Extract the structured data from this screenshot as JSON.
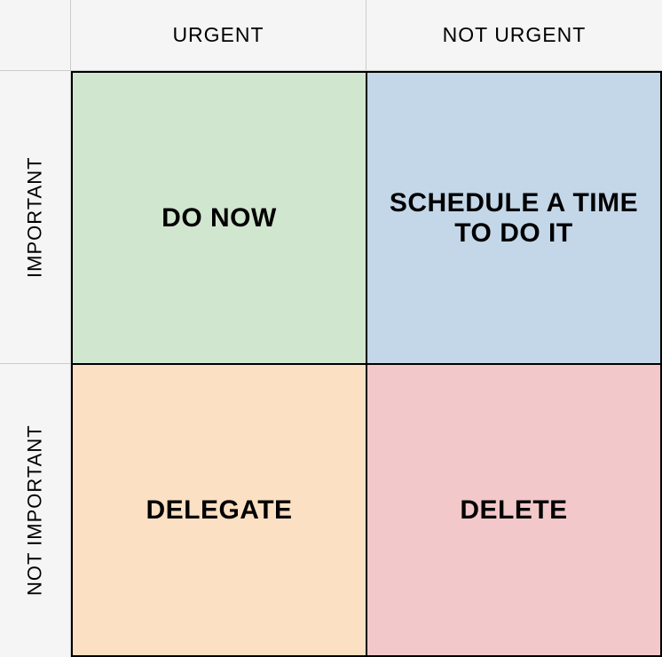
{
  "columns": {
    "urgent": "URGENT",
    "not_urgent": "NOT URGENT"
  },
  "rows": {
    "important": "IMPORTANT",
    "not_important": "NOT IMPORTANT"
  },
  "quadrants": {
    "do_now": {
      "label": "DO NOW",
      "color": "#d1e6ce"
    },
    "schedule": {
      "label": "SCHEDULE A TIME TO DO IT",
      "color": "#c3d7e8"
    },
    "delegate": {
      "label": "DELEGATE",
      "color": "#fbe0c3"
    },
    "delete": {
      "label": "DELETE",
      "color": "#f3c8ca"
    }
  }
}
